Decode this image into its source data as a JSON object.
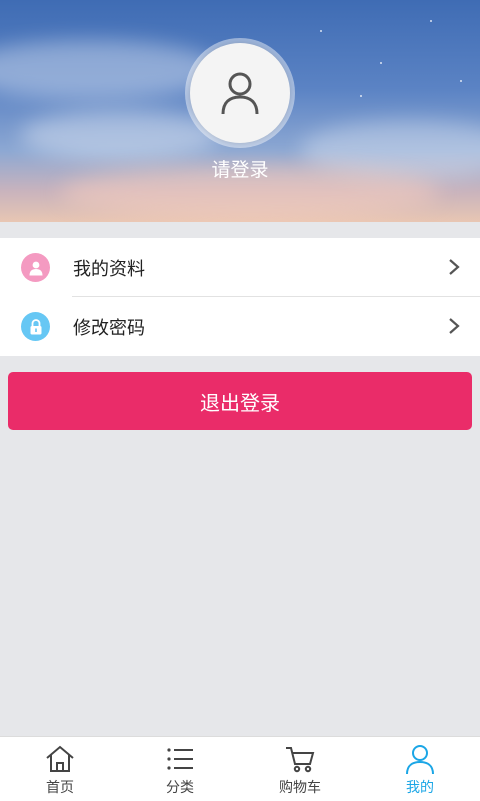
{
  "profile": {
    "login_prompt": "请登录",
    "avatar_icon": "user-icon"
  },
  "menu": {
    "items": [
      {
        "label": "我的资料",
        "icon": "user-icon",
        "icon_color": "#f49ac1"
      },
      {
        "label": "修改密码",
        "icon": "lock-icon",
        "icon_color": "#66c7f4"
      }
    ]
  },
  "logout": {
    "label": "退出登录",
    "color": "#ea2c69"
  },
  "tabbar": {
    "active_color": "#1ba6e6",
    "tabs": [
      {
        "label": "首页",
        "icon": "home-icon"
      },
      {
        "label": "分类",
        "icon": "list-icon"
      },
      {
        "label": "购物车",
        "icon": "cart-icon"
      },
      {
        "label": "我的",
        "icon": "user-icon",
        "active": true
      }
    ]
  }
}
